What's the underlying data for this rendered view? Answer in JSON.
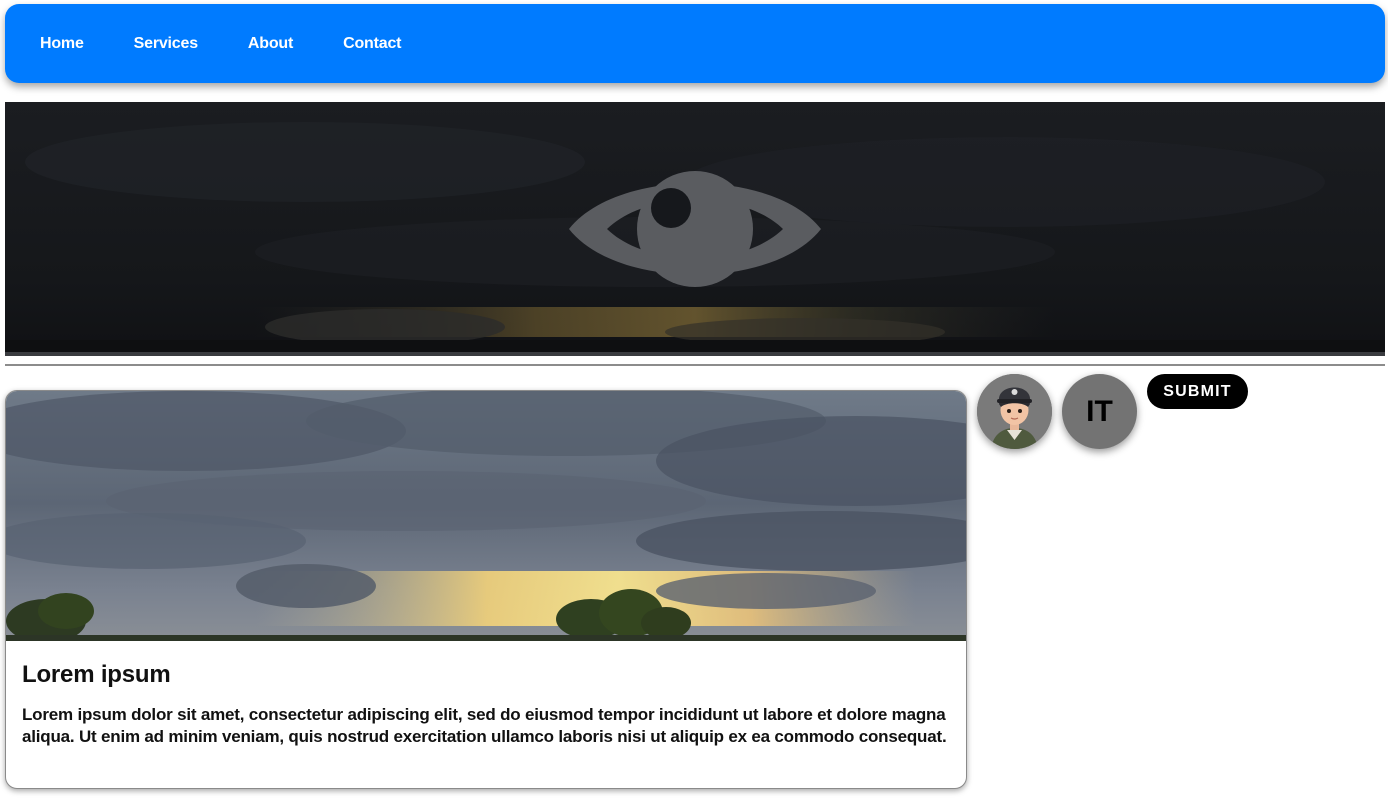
{
  "nav": {
    "items": [
      {
        "label": "Home"
      },
      {
        "label": "Services"
      },
      {
        "label": "About"
      },
      {
        "label": "Contact"
      }
    ]
  },
  "hero": {
    "icon": "eye-icon",
    "colors": {
      "overlay": "#16181c",
      "icon": "#5a5c60"
    }
  },
  "card": {
    "title": "Lorem ipsum",
    "text": "Lorem ipsum dolor sit amet, consectetur adipiscing elit, sed do eiusmod tempor incididunt ut labore et dolore magna aliqua. Ut enim ad minim veniam, quis nostrud exercitation ullamco laboris nisi ut aliquip ex ea commodo consequat."
  },
  "avatars": {
    "initials": "IT"
  },
  "actions": {
    "submit_label": "SUBMIT"
  },
  "colors": {
    "nav_bg": "#007bff",
    "button_bg": "#000000",
    "avatar_bg": "#737373"
  }
}
